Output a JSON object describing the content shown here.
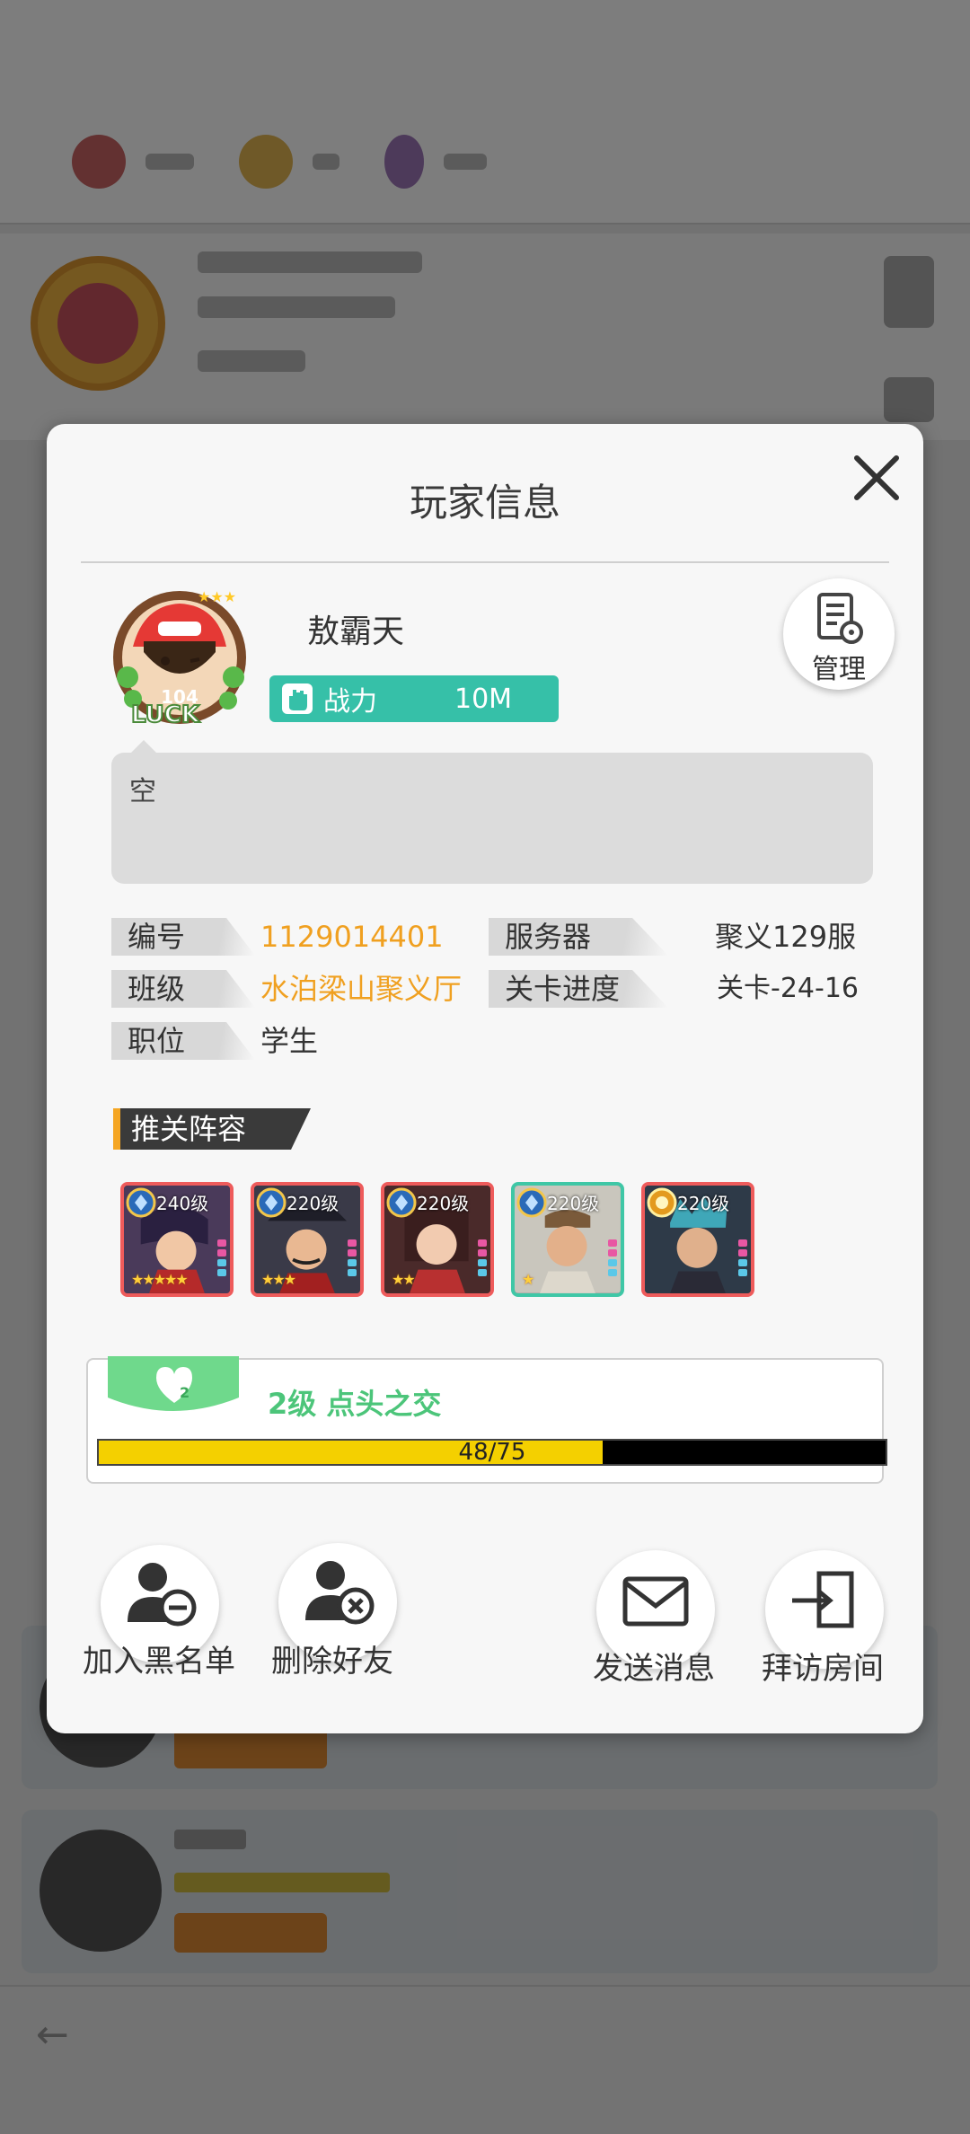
{
  "dialog": {
    "title": "玩家信息"
  },
  "player": {
    "name": "敖霸天",
    "avatar_level": "104",
    "power_label": "战力",
    "power_value": "10M",
    "bio": "空"
  },
  "manage_button": {
    "label": "管理"
  },
  "info": {
    "id_label": "编号",
    "id_value": "1129014401",
    "server_label": "服务器",
    "server_value": "聚义129服",
    "class_label": "班级",
    "class_value": "水泊梁山聚义厅",
    "stage_label": "关卡进度",
    "stage_value": "关卡-24-16",
    "role_label": "职位",
    "role_value": "学生"
  },
  "lineup": {
    "title": "推关阵容",
    "heroes": [
      {
        "level": "240级",
        "stars": "★★★★★",
        "frame": "red"
      },
      {
        "level": "220级",
        "stars": "★★★",
        "frame": "red"
      },
      {
        "level": "220级",
        "stars": "★★",
        "frame": "red"
      },
      {
        "level": "220级",
        "stars": "★",
        "frame": "cyan"
      },
      {
        "level": "220级",
        "stars": "",
        "frame": "red"
      }
    ]
  },
  "friendship": {
    "heart_level": "2",
    "title": "2级 点头之交",
    "progress_text": "48/75",
    "progress_fraction": 0.64
  },
  "actions": {
    "blacklist": "加入黑名单",
    "delete_friend": "删除好友",
    "send_message": "发送消息",
    "visit_room": "拜访房间"
  },
  "colors": {
    "accent_teal": "#36c0a8",
    "orange": "#f0a020",
    "progress_fill": "#f4d000",
    "friend_green": "#4cc57a"
  }
}
